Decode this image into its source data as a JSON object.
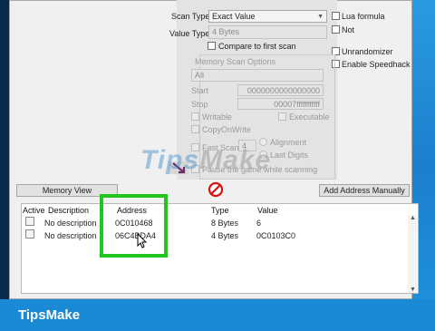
{
  "scan": {
    "scan_type_label": "Scan Type",
    "scan_type_value": "Exact Value",
    "value_type_label": "Value Type",
    "value_type_value": "4 Bytes",
    "compare_first": "Compare to first scan",
    "lua_formula": "Lua formula",
    "not_label": "Not",
    "unrandomizer": "Unrandomizer",
    "enable_speedhack": "Enable Speedhack"
  },
  "memory_options": {
    "title": "Memory Scan Options",
    "region": "All",
    "start_label": "Start",
    "start_value": "0000000000000000",
    "stop_label": "Stop",
    "stop_value": "00007fffffffffff",
    "writable": "Writable",
    "executable": "Executable",
    "copy_on_write": "CopyOnWrite",
    "fast_scan": "Fast Scan",
    "fast_scan_value": "4",
    "alignment": "Alignment",
    "last_digits": "Last Digits",
    "pause_text": "Pause the game while scanning"
  },
  "buttons": {
    "memory_view": "Memory View",
    "add_address": "Add Address Manually"
  },
  "results": {
    "headers": [
      "Active",
      "Description",
      "Address",
      "Type",
      "Value"
    ],
    "rows": [
      {
        "description": "No description",
        "address": "0C010468",
        "type": "8 Bytes",
        "value": "6"
      },
      {
        "description": "No description",
        "address": "06C4BDA4",
        "type": "4 Bytes",
        "value": "0C0103C0"
      }
    ]
  },
  "watermark": {
    "tips": "Tips",
    "make": "Make"
  },
  "footer": {
    "brand": "TipsMake"
  }
}
